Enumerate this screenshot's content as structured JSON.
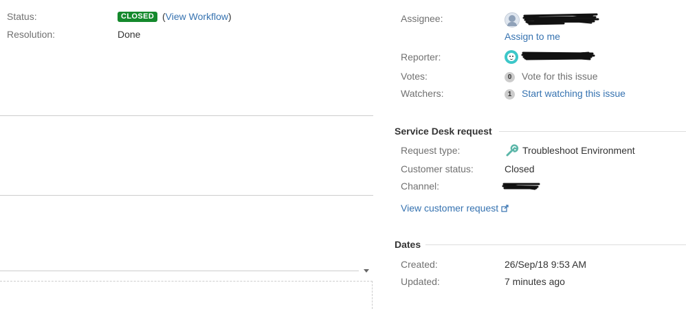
{
  "details": {
    "status_label": "Status:",
    "status_value": "CLOSED",
    "open_paren": "(",
    "view_workflow": "View Workflow",
    "close_paren": ")",
    "resolution_label": "Resolution:",
    "resolution_value": "Done"
  },
  "people": {
    "assignee_label": "Assignee:",
    "assign_to_me": "Assign to me",
    "reporter_label": "Reporter:",
    "votes_label": "Votes:",
    "votes_count": "0",
    "vote_link": "Vote for this issue",
    "watchers_label": "Watchers:",
    "watchers_count": "1",
    "watch_link": "Start watching this issue"
  },
  "service_desk": {
    "heading": "Service Desk request",
    "request_type_label": "Request type:",
    "request_type_value": "Troubleshoot Environment",
    "customer_status_label": "Customer status:",
    "customer_status_value": "Closed",
    "channel_label": "Channel:",
    "view_customer_request": "View customer request"
  },
  "dates": {
    "heading": "Dates",
    "created_label": "Created:",
    "created_value": "26/Sep/18 9:53 AM",
    "updated_label": "Updated:",
    "updated_value": "7 minutes ago"
  },
  "colors": {
    "link": "#3572b0",
    "lozenge_closed": "#14892c",
    "label": "#707070"
  },
  "icons": {
    "request_type": "wrench-icon",
    "external_link": "external-link-icon",
    "assignee_avatar": "default-user-avatar",
    "reporter_avatar": "smiley-avatar"
  }
}
